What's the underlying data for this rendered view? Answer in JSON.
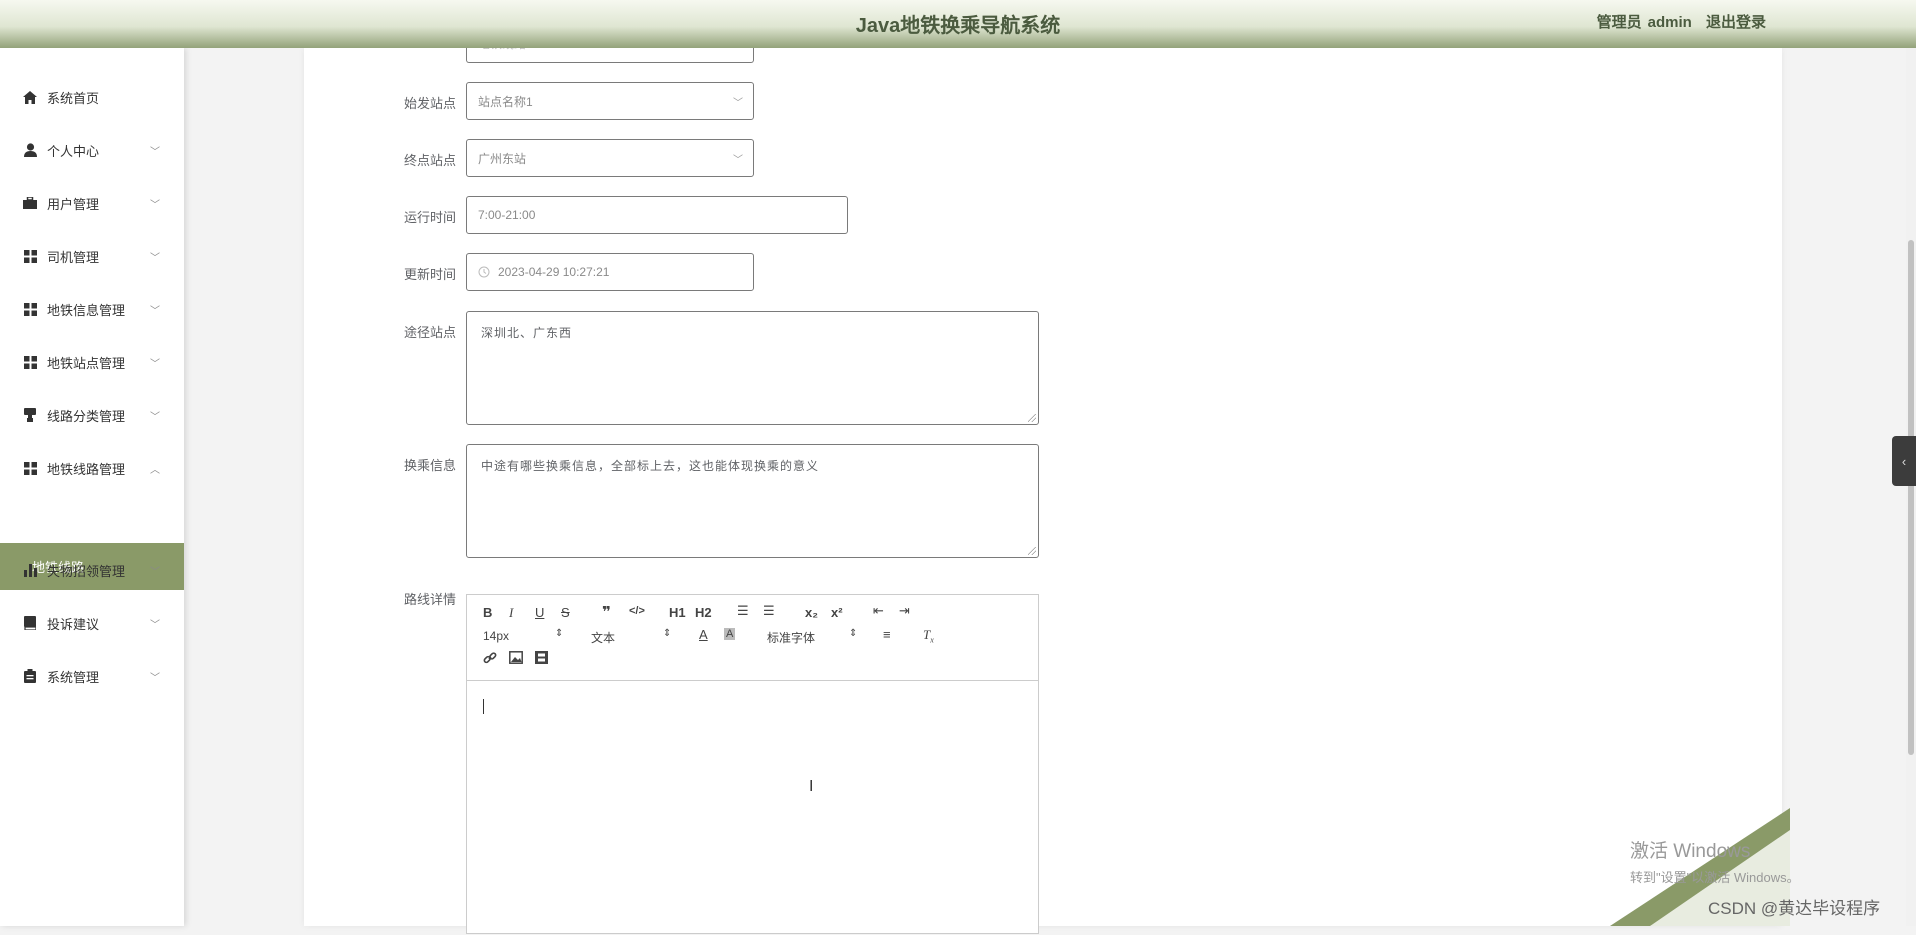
{
  "header": {
    "app_title": "Java地铁换乘导航系统",
    "user_role": "管理员",
    "username": "admin",
    "logout_label": "退出登录"
  },
  "sidebar": {
    "items": [
      {
        "label": "系统首页",
        "icon": "home-icon"
      },
      {
        "label": "个人中心",
        "icon": "person-icon"
      },
      {
        "label": "用户管理",
        "icon": "briefcase-icon"
      },
      {
        "label": "司机管理",
        "icon": "grid-icon"
      },
      {
        "label": "地铁信息管理",
        "icon": "grid-icon"
      },
      {
        "label": "地铁站点管理",
        "icon": "grid-icon"
      },
      {
        "label": "线路分类管理",
        "icon": "stamp-icon"
      },
      {
        "label": "地铁线路管理",
        "icon": "grid-icon"
      },
      {
        "label": "失物招领管理",
        "icon": "bar-chart-icon"
      },
      {
        "label": "投诉建议",
        "icon": "book-icon"
      },
      {
        "label": "系统管理",
        "icon": "clipboard-icon"
      }
    ],
    "active_submenu": "地铁线路"
  },
  "form": {
    "partial_top_value": "地铁线路",
    "start_station": {
      "label": "始发站点",
      "value": "站点名称1"
    },
    "end_station": {
      "label": "终点站点",
      "value": "广州东站"
    },
    "run_time": {
      "label": "运行时间",
      "value": "7:00-21:00"
    },
    "update_time": {
      "label": "更新时间",
      "value": "2023-04-29 10:27:21"
    },
    "via_stations": {
      "label": "途径站点",
      "value": "深圳北、广东西"
    },
    "transfer_info": {
      "label": "换乘信息",
      "value": "中途有哪些换乘信息，全部标上去，这也能体现换乘的意义"
    },
    "route_detail": {
      "label": "路线详情"
    }
  },
  "editor_toolbar": {
    "font_size": "14px",
    "paragraph": "文本",
    "font_family": "标准字体",
    "h1": "H1",
    "h2": "H2",
    "subscript": "x₂",
    "superscript": "x²"
  },
  "watermark": {
    "line1": "激活 Windows",
    "line2": "转到\"设置\"以激活 Windows。",
    "csdn": "CSDN @黄达毕设程序"
  },
  "colors": {
    "accent": "#8a9a68",
    "header_text": "#4b5b3f"
  }
}
